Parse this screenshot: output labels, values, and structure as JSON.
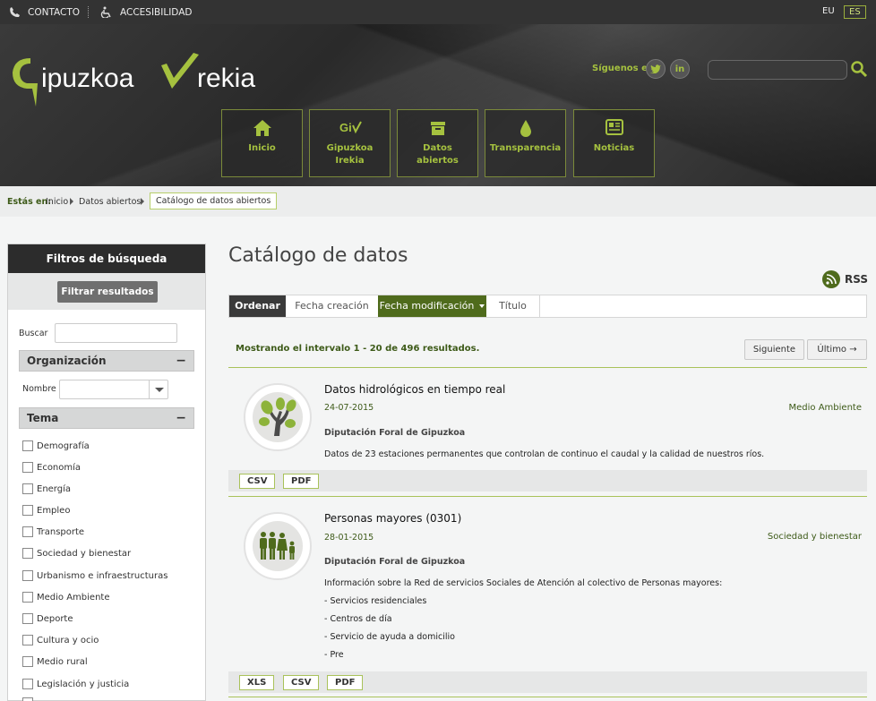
{
  "topbar": {
    "contact": "CONTACTO",
    "accessibility": "ACCESIBILIDAD",
    "lang_eu": "EU",
    "lang_es": "ES"
  },
  "header": {
    "logo_text": "Gipuzkoa Irekia",
    "follow": "Síguenos en",
    "social": [
      "twitter-icon",
      "linkedin-icon"
    ],
    "nav": [
      {
        "icon": "home-icon",
        "label": "Inicio"
      },
      {
        "icon": "gi-logo-icon",
        "label": "Gipuzkoa Irekia"
      },
      {
        "icon": "open-data-icon",
        "label": "Datos abiertos"
      },
      {
        "icon": "drop-icon",
        "label": "Transparencia"
      },
      {
        "icon": "news-icon",
        "label": "Noticias"
      }
    ]
  },
  "breadcrumb": {
    "prefix": "Estás en:",
    "items": [
      "Inicio",
      "Datos abiertos"
    ],
    "current": "Catálogo de datos abiertos"
  },
  "sidebar": {
    "title": "Filtros de búsqueda",
    "filter_button": "Filtrar resultados",
    "search_label": "Buscar",
    "organization": "Organización",
    "name_label": "Nombre",
    "topic_header": "Tema",
    "topics": [
      "Demografía",
      "Economía",
      "Energía",
      "Empleo",
      "Transporte",
      "Sociedad y bienestar",
      "Urbanismo e infraestructuras",
      "Medio Ambiente",
      "Deporte",
      "Cultura y ocio",
      "Medio rural",
      "Legislación y justicia"
    ]
  },
  "main": {
    "title": "Catálogo de datos",
    "rss": "RSS",
    "sort": {
      "label": "Ordenar",
      "options": [
        "Fecha creación",
        "Fecha modificación",
        "Título"
      ]
    },
    "results": "Mostrando el intervalo 1 - 20 de 496 resultados.",
    "next": "Siguiente",
    "last": "Último →",
    "items": [
      {
        "title": "Datos hidrológicos en tiempo real",
        "date": "24-07-2015",
        "category": "Medio Ambiente",
        "org": "Diputación Foral de Gipuzkoa",
        "desc": [
          "Datos de 23 estaciones permanentes que controlan de continuo el caudal y la calidad de nuestros ríos."
        ],
        "formats": [
          "CSV",
          "PDF"
        ],
        "icon": "tree-icon"
      },
      {
        "title": "Personas mayores (0301)",
        "date": "28-01-2015",
        "category": "Sociedad y bienestar",
        "org": "Diputación Foral de Gipuzkoa",
        "desc": [
          "Información sobre la Red de servicios Sociales de Atención al colectivo de Personas mayores:",
          "- Servicios residenciales",
          "- Centros de día",
          "- Servicio de ayuda a domicilio",
          "- Pre"
        ],
        "formats": [
          "XLS",
          "CSV",
          "PDF"
        ],
        "icon": "people-icon"
      }
    ]
  },
  "colors": {
    "accent": "#a5c13f",
    "dark_green": "#4f6b1c",
    "text_green": "#3d5a18"
  }
}
